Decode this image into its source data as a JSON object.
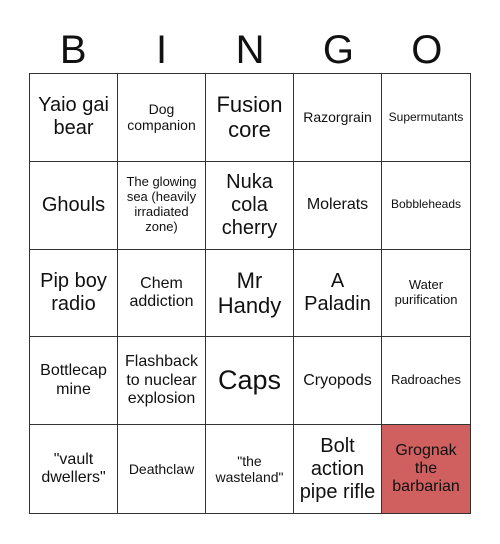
{
  "header": [
    "B",
    "I",
    "N",
    "G",
    "O"
  ],
  "marked_color": "#d06060",
  "cells": [
    {
      "text": "Yaio gai bear",
      "marked": false
    },
    {
      "text": "Dog companion",
      "marked": false
    },
    {
      "text": "Fusion core",
      "marked": false
    },
    {
      "text": "Razorgrain",
      "marked": false
    },
    {
      "text": "Supermutants",
      "marked": false
    },
    {
      "text": "Ghouls",
      "marked": false
    },
    {
      "text": "The glowing sea (heavily irradiated zone)",
      "marked": false
    },
    {
      "text": "Nuka cola cherry",
      "marked": false
    },
    {
      "text": "Molerats",
      "marked": false
    },
    {
      "text": "Bobbleheads",
      "marked": false
    },
    {
      "text": "Pip boy radio",
      "marked": false
    },
    {
      "text": "Chem addiction",
      "marked": false
    },
    {
      "text": "Mr Handy",
      "marked": false
    },
    {
      "text": "A Paladin",
      "marked": false
    },
    {
      "text": "Water purification",
      "marked": false
    },
    {
      "text": "Bottlecap mine",
      "marked": false
    },
    {
      "text": "Flashback to nuclear explosion",
      "marked": false
    },
    {
      "text": "Caps",
      "marked": false
    },
    {
      "text": "Cryopods",
      "marked": false
    },
    {
      "text": "Radroaches",
      "marked": false
    },
    {
      "text": "\"vault dwellers\"",
      "marked": false
    },
    {
      "text": "Deathclaw",
      "marked": false
    },
    {
      "text": "\"the wasteland\"",
      "marked": false
    },
    {
      "text": "Bolt action pipe rifle",
      "marked": false
    },
    {
      "text": "Grognak the barbarian",
      "marked": true
    }
  ]
}
